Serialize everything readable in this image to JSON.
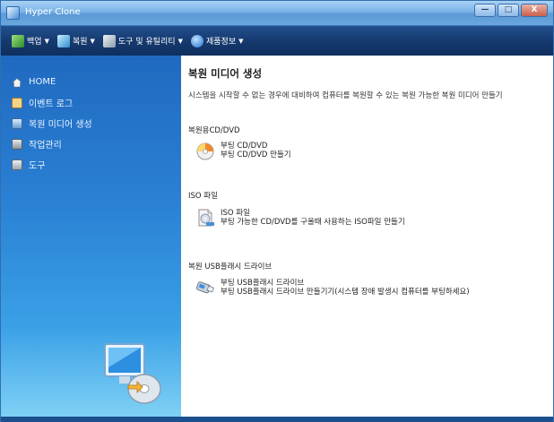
{
  "window": {
    "title": "Hyper Clone",
    "buttons": {
      "minimize": "—",
      "maximize": "□",
      "close": "X"
    }
  },
  "menubar": [
    {
      "label": "백업",
      "icon": "backup-icon",
      "color": "#4caf50"
    },
    {
      "label": "복원",
      "icon": "restore-icon",
      "color": "#4fb3e8"
    },
    {
      "label": "도구 및 유틸리티",
      "icon": "tools-icon",
      "color": "#b8c4d0"
    },
    {
      "label": "제품정보",
      "icon": "info-icon",
      "color": "#3a8fe0"
    }
  ],
  "sidebar": {
    "items": [
      {
        "label": "HOME",
        "icon": "home-icon",
        "color": "#f2f2f2"
      },
      {
        "label": "이벤트 로그",
        "icon": "log-icon",
        "color": "#e0a040"
      },
      {
        "label": "복원 미디어 생성",
        "icon": "media-icon",
        "color": "#8fb8e0"
      },
      {
        "label": "작업관리",
        "icon": "task-icon",
        "color": "#a0a8b0"
      },
      {
        "label": "도구",
        "icon": "tool-icon",
        "color": "#c0c8d0"
      }
    ]
  },
  "main": {
    "title": "복원 미디어 생성",
    "description": "시스템을 시작할 수 없는 경우에 대비하여 컴퓨터를 복원할 수 있는 복원 가능한 복원 미디어 만들기",
    "sections": [
      {
        "heading": "복원용CD/DVD",
        "icon": "cd-dvd-icon",
        "title": "부팅 CD/DVD",
        "desc": "부팅 CD/DVD 만들기"
      },
      {
        "heading": "ISO 파일",
        "icon": "iso-file-icon",
        "title": "ISO 파일",
        "desc": "부팅 가능한 CD/DVD를 구울때 사용하는 ISO파일 만들기"
      },
      {
        "heading": "복원 USB플래시 드라이브",
        "icon": "usb-drive-icon",
        "title": "부팅 USB플래시 드라이브",
        "desc": "부팅 USB플래시 드라이브 만들기기(시스템 장애 발생시 컴퓨터를 부팅하세요)"
      }
    ]
  }
}
